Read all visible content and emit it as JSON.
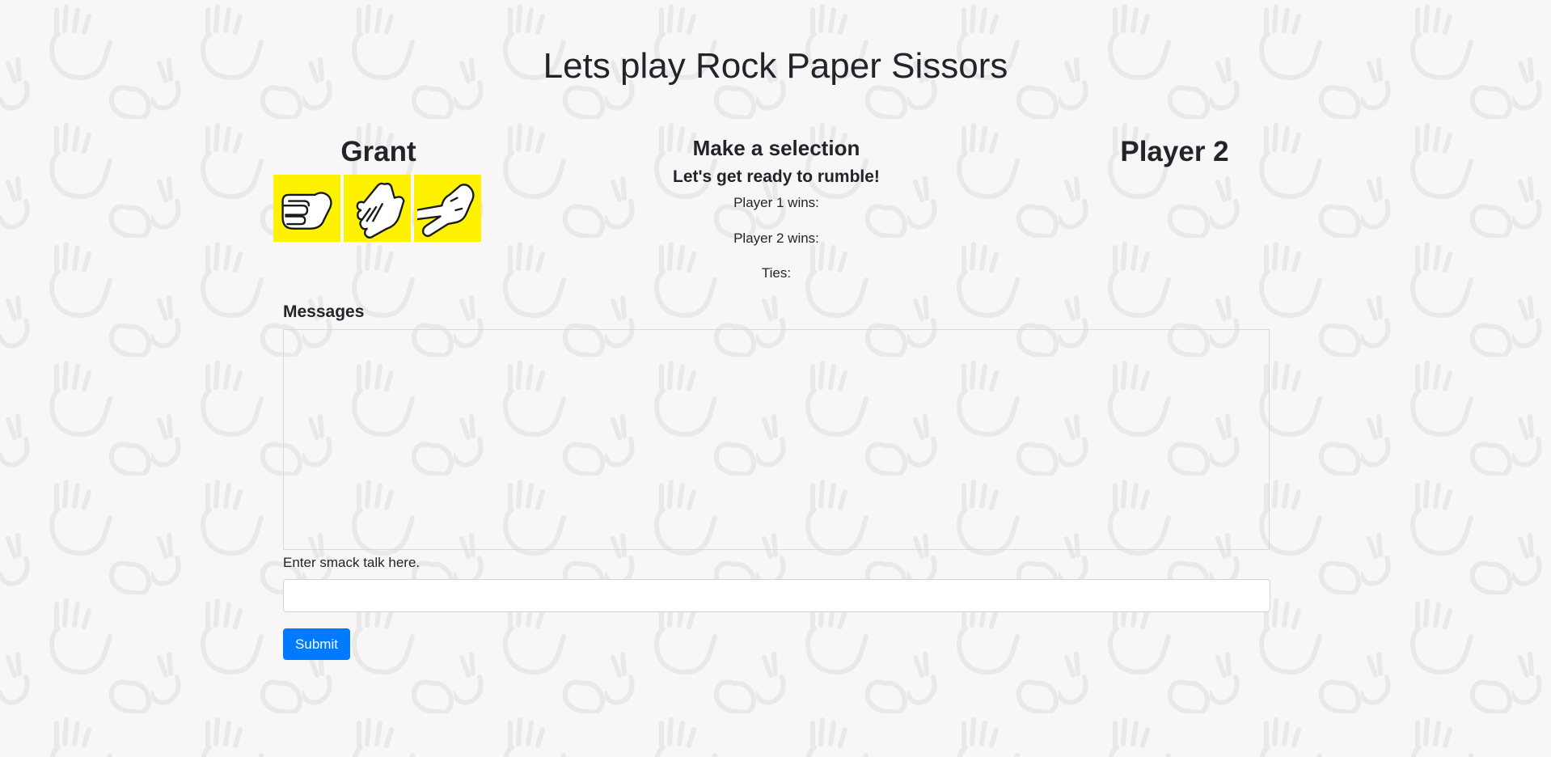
{
  "page": {
    "title": "Lets play Rock Paper Sissors"
  },
  "player1": {
    "name": "Grant",
    "choices": [
      {
        "name": "rock",
        "icon": "rock-hand-icon"
      },
      {
        "name": "paper",
        "icon": "paper-hand-icon"
      },
      {
        "name": "scissors",
        "icon": "scissors-hand-icon"
      }
    ]
  },
  "status": {
    "heading": "Make a selection",
    "message": "Let's get ready to rumble!",
    "player1_wins_label": "Player 1 wins:",
    "player2_wins_label": "Player 2 wins:",
    "ties_label": "Ties:"
  },
  "player2": {
    "name": "Player 2"
  },
  "chat": {
    "heading": "Messages",
    "input_label": "Enter smack talk here.",
    "input_value": "",
    "submit_label": "Submit"
  },
  "colors": {
    "background": "#f8f6f7",
    "choice_background": "#fff200",
    "button": "#007bff",
    "text": "#212529"
  }
}
